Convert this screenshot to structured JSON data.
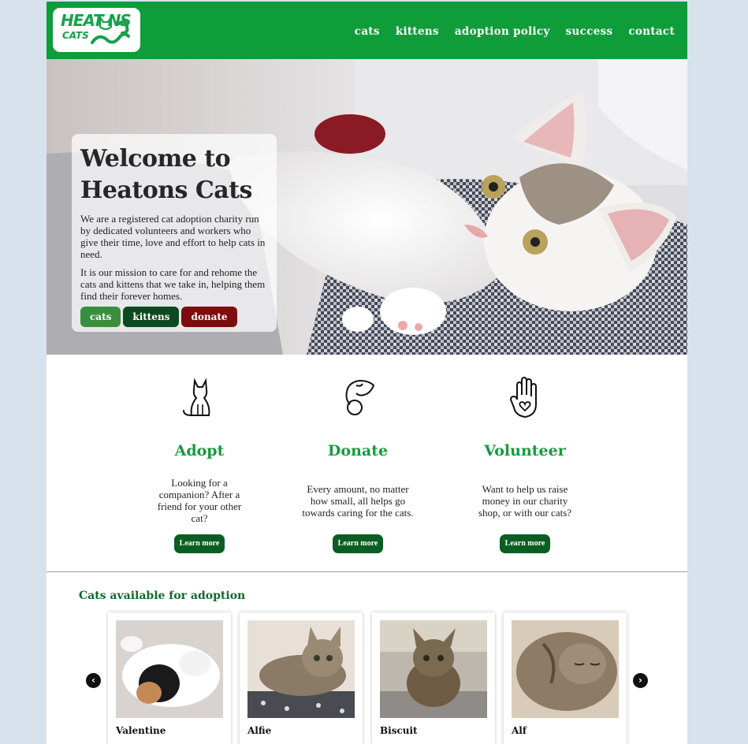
{
  "header": {
    "logo_text": "HEAT NS",
    "logo_sub": "CATS",
    "nav": [
      "cats",
      "kittens",
      "adoption policy",
      "success",
      "contact"
    ]
  },
  "hero": {
    "title": "Welcome to Heatons Cats",
    "paragraph1": "We are a registered cat adoption charity run by dedicated volunteers and workers who give their time, love and effort to help cats in need.",
    "paragraph2": "It is our mission to care for and rehome the cats and kittens that we take in, helping them find their forever homes.",
    "buttons": {
      "cats": "cats",
      "kittens": "kittens",
      "donate": "donate"
    }
  },
  "features": [
    {
      "icon": "cat-outline-icon",
      "title": "Adopt",
      "text": "Looking for a companion? After a friend for your other cat?",
      "button": "Learn more"
    },
    {
      "icon": "hand-coin-icon",
      "title": "Donate",
      "text": "Every amount, no matter how small, all helps go towards caring for the cats.",
      "button": "Learn more"
    },
    {
      "icon": "raised-hand-heart-icon",
      "title": "Volunteer",
      "text": "Want to help us raise money in our charity shop, or with our cats?",
      "button": "Learn more"
    }
  ],
  "adoption": {
    "title": "Cats available for adoption",
    "cats": [
      {
        "name": "Valentine"
      },
      {
        "name": "Alfie"
      },
      {
        "name": "Biscuit"
      },
      {
        "name": "Alf"
      }
    ],
    "prev_icon": "chevron-left-circle-icon",
    "next_icon": "chevron-right-circle-icon"
  },
  "colors": {
    "brand_green": "#0f9d3a",
    "heading_green": "#179a3f",
    "dark_green": "#0b5e21",
    "donate_red": "#7d0c0c",
    "page_bg": "#d8e2ec"
  }
}
